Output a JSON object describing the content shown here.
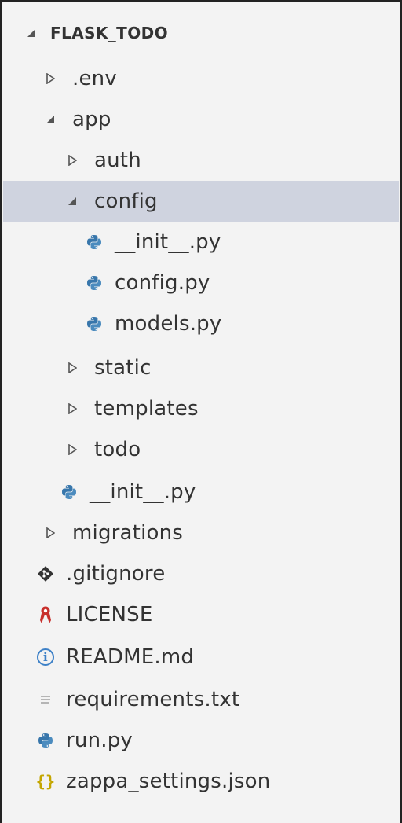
{
  "explorer": {
    "root": {
      "label": "FLASK_TODO",
      "expanded": true
    },
    "items": [
      {
        "label": ".env",
        "kind": "folder",
        "expanded": false,
        "depth": 1
      },
      {
        "label": "app",
        "kind": "folder",
        "expanded": true,
        "depth": 1
      },
      {
        "label": "auth",
        "kind": "folder",
        "expanded": false,
        "depth": 2
      },
      {
        "label": "config",
        "kind": "folder",
        "expanded": true,
        "depth": 2,
        "selected": true
      },
      {
        "label": "__init__.py",
        "kind": "python-file",
        "icon": "python-icon",
        "depth": 3
      },
      {
        "label": "config.py",
        "kind": "python-file",
        "icon": "python-icon",
        "depth": 3
      },
      {
        "label": "models.py",
        "kind": "python-file",
        "icon": "python-icon",
        "depth": 3
      },
      {
        "label": "static",
        "kind": "folder",
        "expanded": false,
        "depth": 2
      },
      {
        "label": "templates",
        "kind": "folder",
        "expanded": false,
        "depth": 2
      },
      {
        "label": "todo",
        "kind": "folder",
        "expanded": false,
        "depth": 2
      },
      {
        "label": "__init__.py",
        "kind": "python-file",
        "icon": "python-icon",
        "depth": 2
      },
      {
        "label": "migrations",
        "kind": "folder",
        "expanded": false,
        "depth": 1
      },
      {
        "label": ".gitignore",
        "kind": "git-file",
        "icon": "git-icon",
        "depth": 1
      },
      {
        "label": "LICENSE",
        "kind": "license-file",
        "icon": "license-icon",
        "depth": 1
      },
      {
        "label": "README.md",
        "kind": "info-file",
        "icon": "info-icon",
        "depth": 1
      },
      {
        "label": "requirements.txt",
        "kind": "text-file",
        "icon": "text-lines-icon",
        "depth": 1
      },
      {
        "label": "run.py",
        "kind": "python-file",
        "icon": "python-icon",
        "depth": 1
      },
      {
        "label": "zappa_settings.json",
        "kind": "json-file",
        "icon": "json-braces-icon",
        "depth": 1
      }
    ]
  },
  "colors": {
    "background": "#f3f3f3",
    "selected_row": "#cfd3df",
    "text": "#333333",
    "twist": "#555555",
    "python_blue": "#3776ab",
    "python_teal": "#4b8bbe",
    "git": "#333333",
    "license": "#c8302c",
    "info": "#3c80c7",
    "json": "#c4a600",
    "text_icon": "#9a9a9a"
  }
}
